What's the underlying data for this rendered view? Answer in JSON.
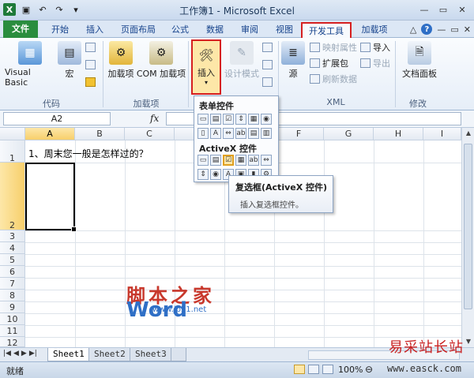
{
  "window": {
    "title": "工作簿1 - Microsoft Excel"
  },
  "tabs": [
    {
      "label": "文件"
    },
    {
      "label": "开始"
    },
    {
      "label": "插入"
    },
    {
      "label": "页面布局"
    },
    {
      "label": "公式"
    },
    {
      "label": "数据"
    },
    {
      "label": "审阅"
    },
    {
      "label": "视图"
    },
    {
      "label": "开发工具"
    },
    {
      "label": "加载项"
    }
  ],
  "ribbon": {
    "code": {
      "visual_basic": "Visual Basic",
      "macro": "宏",
      "group": "代码"
    },
    "addins": {
      "addins": "加载项",
      "com": "COM 加载项",
      "group": "加载项"
    },
    "controls": {
      "insert": "插入",
      "design_mode": "设计模式"
    },
    "xml": {
      "source": "源",
      "map_props": "映射属性",
      "expansion": "扩展包",
      "refresh": "刷新数据",
      "import": "导入",
      "export": "导出",
      "group": "XML"
    },
    "modify": {
      "doc_panel": "文档面板",
      "group": "修改"
    }
  },
  "formula_bar": {
    "name_box": "A2",
    "fx": "fx"
  },
  "grid": {
    "columns": [
      "A",
      "B",
      "C",
      "D",
      "E",
      "F",
      "G",
      "H",
      "I"
    ],
    "rows": [
      "1",
      "2",
      "3",
      "4",
      "5",
      "6",
      "7",
      "8",
      "9",
      "10",
      "11",
      "12"
    ],
    "a1": "1、周末您一般是怎样过的？"
  },
  "dropdown": {
    "form_controls": "表单控件",
    "activex_controls": "ActiveX 控件"
  },
  "tooltip": {
    "title": "复选框(ActiveX 控件)",
    "desc": "插入复选框控件。"
  },
  "sheets": [
    "Sheet1",
    "Sheet2",
    "Sheet3"
  ],
  "status": {
    "ready": "就绪",
    "zoom": "100%"
  },
  "watermarks": {
    "w1": "脚本之家",
    "w2": "Word",
    "w3": "www.jb51.net",
    "w4": "易采站长站",
    "w5": "www.easck.com"
  }
}
